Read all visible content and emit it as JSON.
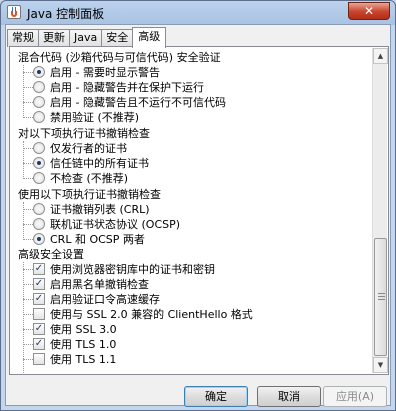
{
  "window": {
    "title": "Java 控制面板",
    "close_glyph": "✕",
    "icon": "java-cup-icon"
  },
  "tabs": [
    {
      "label": "常规",
      "active": false
    },
    {
      "label": "更新",
      "active": false
    },
    {
      "label": "Java",
      "active": false
    },
    {
      "label": "安全",
      "active": false
    },
    {
      "label": "高级",
      "active": true
    }
  ],
  "sections": {
    "mixed_code": {
      "label": "混合代码 (沙箱代码与可信代码) 安全验证",
      "options": [
        {
          "label": "启用 - 需要时显示警告",
          "checked": true
        },
        {
          "label": "启用 - 隐藏警告并在保护下运行",
          "checked": false
        },
        {
          "label": "启用 - 隐藏警告且不运行不可信代码",
          "checked": false
        },
        {
          "label": "禁用验证 (不推荐)",
          "checked": false
        }
      ]
    },
    "cert_revocation_check": {
      "label": "对以下项执行证书撤销检查",
      "options": [
        {
          "label": "仅发行者的证书",
          "checked": false
        },
        {
          "label": "信任链中的所有证书",
          "checked": true
        },
        {
          "label": "不检查 (不推荐)",
          "checked": false
        }
      ]
    },
    "cert_revocation_method": {
      "label": "使用以下项执行证书撤销检查",
      "options": [
        {
          "label": "证书撤销列表 (CRL)",
          "checked": false
        },
        {
          "label": "联机证书状态协议 (OCSP)",
          "checked": false
        },
        {
          "label": "CRL 和 OCSP 两者",
          "checked": true
        }
      ]
    },
    "advanced_security": {
      "label": "高级安全设置",
      "options": [
        {
          "label": "使用浏览器密钥库中的证书和密钥",
          "checked": true
        },
        {
          "label": "启用黑名单撤销检查",
          "checked": true
        },
        {
          "label": "启用验证口令高速缓存",
          "checked": true
        },
        {
          "label": "使用与 SSL 2.0 兼容的 ClientHello 格式",
          "checked": false
        },
        {
          "label": "使用 SSL 3.0",
          "checked": true
        },
        {
          "label": "使用 TLS 1.0",
          "checked": true
        },
        {
          "label": "使用 TLS 1.1",
          "checked": false
        }
      ]
    }
  },
  "buttons": {
    "ok": "确定",
    "cancel": "取消",
    "apply": "应用(A)"
  }
}
